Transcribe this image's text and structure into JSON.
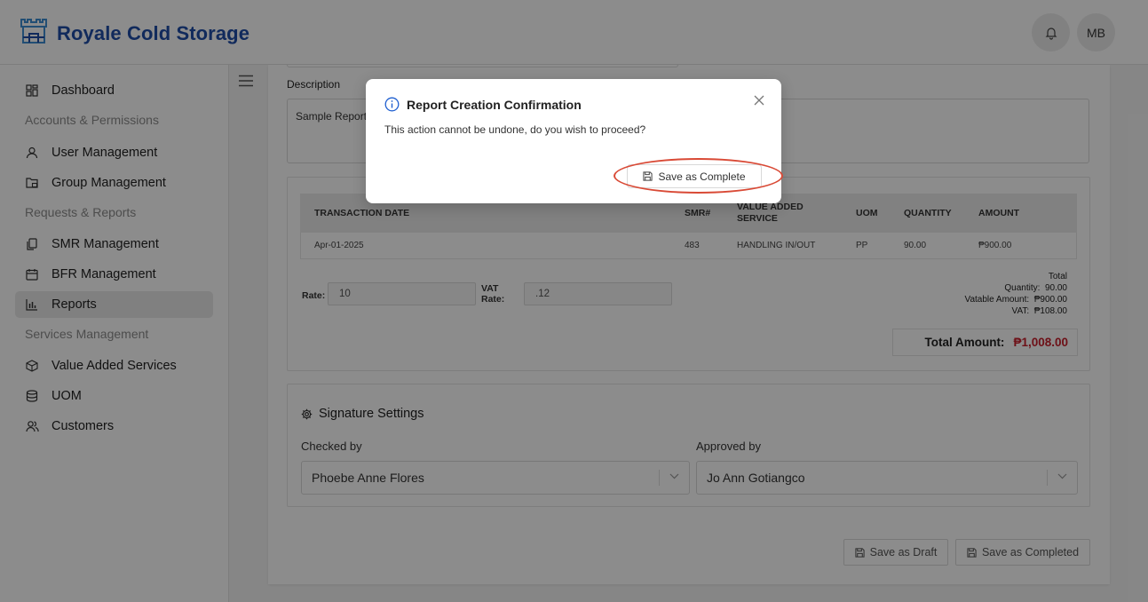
{
  "header": {
    "brand_title": "Royale Cold Storage",
    "avatar_initials": "MB"
  },
  "sidebar": {
    "groups": {
      "accounts": "Accounts & Permissions",
      "requests": "Requests & Reports",
      "services": "Services Management"
    },
    "items": [
      {
        "label": "Dashboard",
        "icon": "dashboard-icon"
      },
      {
        "label": "User Management",
        "icon": "user-icon"
      },
      {
        "label": "Group Management",
        "icon": "folder-lock-icon"
      },
      {
        "label": "SMR Management",
        "icon": "copy-icon"
      },
      {
        "label": "BFR Management",
        "icon": "calendar-icon"
      },
      {
        "label": "Reports",
        "icon": "bar-chart-icon",
        "active": true
      },
      {
        "label": "Value Added Services",
        "icon": "cube-icon"
      },
      {
        "label": "UOM",
        "icon": "database-icon"
      },
      {
        "label": "Customers",
        "icon": "users-icon"
      }
    ]
  },
  "form": {
    "description_label": "Description",
    "description_value": "Sample Report"
  },
  "table": {
    "headers": {
      "date": "TRANSACTION DATE",
      "smr": "SMR#",
      "vas_line1": "VALUE ADDED",
      "vas_line2": "SERVICE",
      "uom": "UOM",
      "quantity": "QUANTITY",
      "amount": "AMOUNT"
    },
    "rows": [
      {
        "date": "Apr-01-2025",
        "smr": "483",
        "vas": "HANDLING IN/OUT",
        "uom": "PP",
        "quantity": "90.00",
        "amount": "₱900.00"
      }
    ]
  },
  "rates": {
    "rate_label": "Rate:",
    "rate_value": "10",
    "vat_label_line1": "VAT",
    "vat_label_line2": "Rate:",
    "vat_value": ".12"
  },
  "totals": {
    "heading": "Total",
    "quantity_label": "Quantity:",
    "quantity_value": "90.00",
    "vatable_label": "Vatable Amount:",
    "vatable_value": "₱900.00",
    "vat_label": "VAT:",
    "vat_value": "₱108.00",
    "total_label": "Total Amount:",
    "total_value": "₱1,008.00"
  },
  "signature": {
    "title": "Signature Settings",
    "checked_label": "Checked by",
    "checked_value": "Phoebe Anne Flores",
    "approved_label": "Approved by",
    "approved_value": "Jo Ann Gotiangco"
  },
  "actions": {
    "save_draft": "Save as Draft",
    "save_completed": "Save as Completed"
  },
  "modal": {
    "title": "Report Creation Confirmation",
    "message": "This action cannot be undone, do you wish to proceed?",
    "confirm_label": "Save as Complete"
  },
  "colors": {
    "brand": "#1f4ea8",
    "total_amount": "#c8202c",
    "highlight": "#d94a36"
  }
}
